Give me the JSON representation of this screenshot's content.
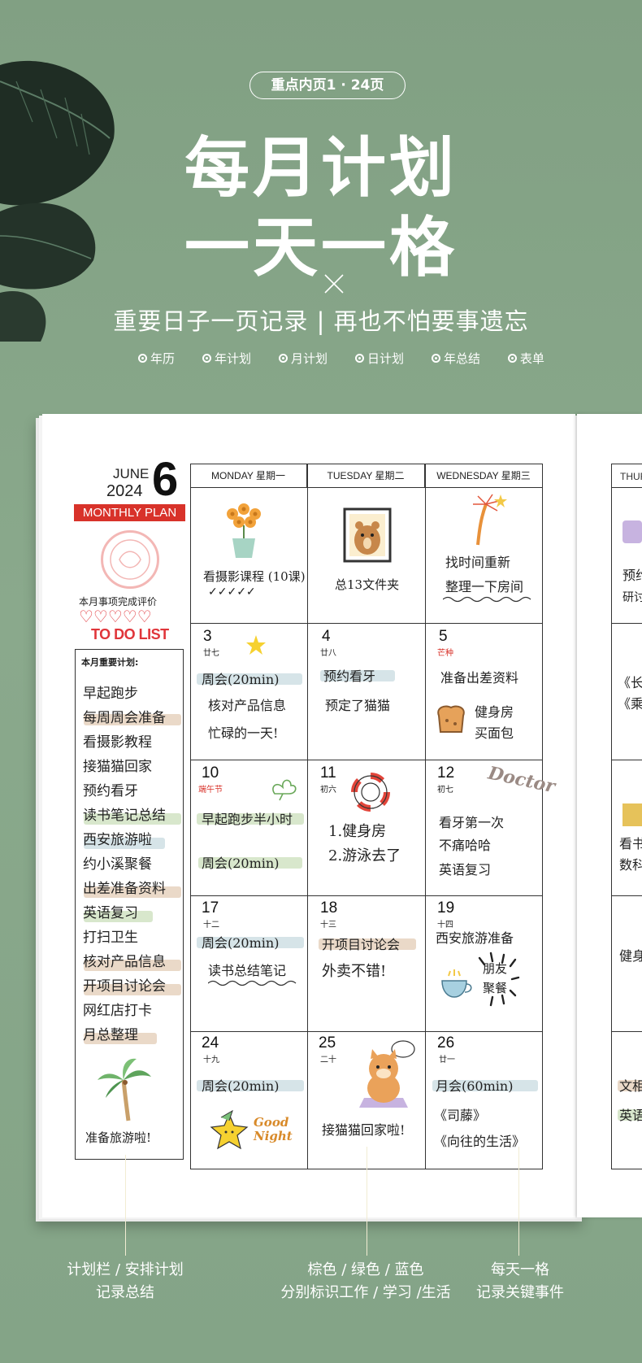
{
  "header": {
    "pill": "重点内页1 · 24页",
    "title_line1": "每月计划",
    "title_line2": "一天一格",
    "subtitle": "重要日子一页记录 | 再也不怕要事遗忘",
    "features": [
      "年历",
      "年计划",
      "月计划",
      "日计划",
      "年总结",
      "表单"
    ]
  },
  "planner": {
    "month_label": "JUNE",
    "year": "2024",
    "month_number": "6",
    "monthly_plan_label": "MONTHLY PLAN",
    "evaluation_label": "本月事项完成评价",
    "hearts": "♡♡♡♡♡",
    "todo_label": "TO DO LIST",
    "plan_heading": "本月重要计划:",
    "plan_items": [
      "早起跑步",
      "每周周会准备",
      "看摄影教程",
      "接猫猫回家",
      "预约看牙",
      "读书笔记总结",
      "西安旅游啦",
      "约小溪聚餐",
      "出差准备资料",
      "英语复习",
      "打扫卫生",
      "核对产品信息",
      "开项目讨论会",
      "网红店打卡",
      "月总整理"
    ],
    "plan_footer": "准备旅游啦!",
    "weekdays": [
      "MONDAY   星期一",
      "TUESDAY   星期二",
      "WEDNESDAY   星期三"
    ],
    "partial_weekday": "THUR",
    "cells": {
      "r1c1": {
        "notes": [
          "看摄影课程 (10课)",
          "✓✓✓✓✓"
        ]
      },
      "r1c2": {
        "notes": [
          "总13文件夹"
        ]
      },
      "r1c3": {
        "notes": [
          "找时间重新",
          "整理一下房间"
        ]
      },
      "r2c1": {
        "day": "3",
        "lunar": "廿七",
        "notes": [
          "周会(20min)",
          "核对产品信息",
          "忙碌的一天!"
        ]
      },
      "r2c2": {
        "day": "4",
        "lunar": "廿八",
        "notes": [
          "预约看牙",
          "预定了猫猫"
        ]
      },
      "r2c3": {
        "day": "5",
        "lunar": "芒种",
        "notes": [
          "准备出差资料",
          "健身房",
          "买面包"
        ]
      },
      "r3c1": {
        "day": "10",
        "lunar": "端午节",
        "notes": [
          "早起跑步半小时",
          "周会(20min)"
        ]
      },
      "r3c2": {
        "day": "11",
        "lunar": "初六",
        "notes": [
          "1.健身房",
          "2.游泳去了"
        ]
      },
      "r3c3": {
        "day": "12",
        "lunar": "初七",
        "sticker": "Doctor",
        "notes": [
          "看牙第一次",
          "不痛哈哈",
          "英语复习"
        ]
      },
      "r4c1": {
        "day": "17",
        "lunar": "十二",
        "notes": [
          "周会(20min)",
          "读书总结笔记"
        ]
      },
      "r4c2": {
        "day": "18",
        "lunar": "十三",
        "notes": [
          "开项目讨论会",
          "外卖不错!"
        ]
      },
      "r4c3": {
        "day": "19",
        "lunar": "十四",
        "notes": [
          "西安旅游准备",
          "朋友",
          "聚餐"
        ]
      },
      "r5c1": {
        "day": "24",
        "lunar": "十九",
        "sticker": "Good Night",
        "notes": [
          "周会(20min)"
        ]
      },
      "r5c2": {
        "day": "25",
        "lunar": "二十",
        "notes": [
          "接猫猫回家啦!"
        ]
      },
      "r5c3": {
        "day": "26",
        "lunar": "廿一",
        "notes": [
          "月会(60min)",
          "《司藤》",
          "《向往的生活》"
        ]
      }
    },
    "right_partial_notes": [
      "预约",
      "研讨",
      "《长",
      "《乘",
      "看书",
      "数科",
      "健身",
      "文相",
      "英语"
    ]
  },
  "captions": {
    "left": [
      "计划栏 / 安排计划",
      "记录总结"
    ],
    "middle": [
      "棕色 / 绿色 / 蓝色",
      "分别标识工作 / 学习 /生活"
    ],
    "right": [
      "每天一格",
      "记录关键事件"
    ]
  },
  "colors": {
    "background": "#86a488",
    "accent_red": "#d8322a",
    "highlight_brown": "#d9b99a",
    "highlight_green": "#b8d3a3",
    "highlight_blue": "#b4cdd6"
  }
}
